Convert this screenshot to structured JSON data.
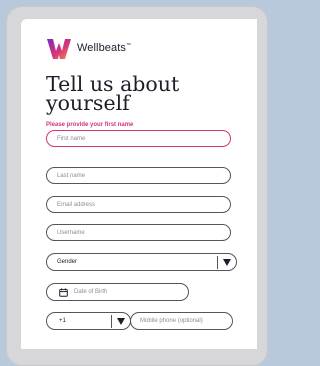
{
  "brand": {
    "name": "Wellbeats",
    "trademark": "™",
    "colors": [
      "#7b2cbf",
      "#d6337a",
      "#f28c4b"
    ]
  },
  "form": {
    "heading": "Tell us about yourself",
    "error_message": "Please provide your first name",
    "error_color": "#d6337a",
    "first_name_placeholder": "First name",
    "last_name_placeholder": "Last name",
    "email_placeholder": "Email address",
    "username_placeholder": "Username",
    "gender_selected": "Gender",
    "dob_placeholder": "Date of Birth",
    "country_code_selected": "+1",
    "phone_placeholder": "Mobile phone (optional)"
  },
  "icons": {
    "logo": "wellbeats-logo-icon",
    "calendar": "calendar-icon",
    "dropdown": "chevron-down-icon"
  }
}
